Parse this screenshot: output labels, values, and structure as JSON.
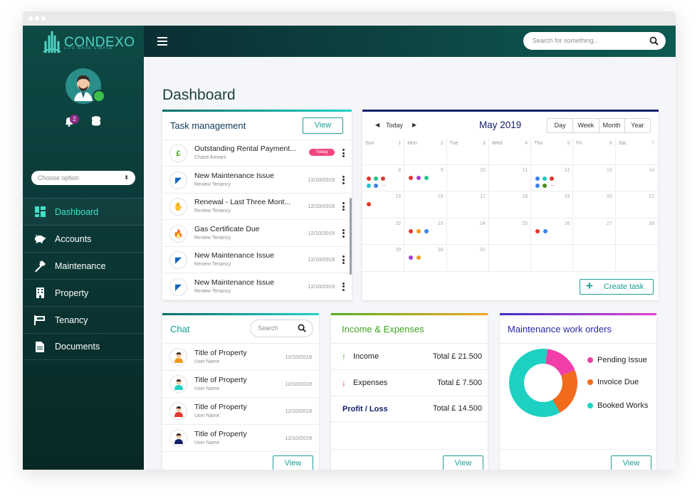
{
  "brand": {
    "name": "CONDEXO",
    "tagline": "LIFE MADE SIMPLE",
    "primary": "#0e4a45",
    "accent": "#3fe0c8"
  },
  "sidebar": {
    "notification_count": "2",
    "choose_option": "Choose option",
    "items": [
      {
        "label": "Dashboard",
        "icon": "dashboard-icon",
        "active": true
      },
      {
        "label": "Accounts",
        "icon": "piggy-bank-icon"
      },
      {
        "label": "Maintenance",
        "icon": "hammer-icon"
      },
      {
        "label": "Property",
        "icon": "building-icon"
      },
      {
        "label": "Tenancy",
        "icon": "flag-icon"
      },
      {
        "label": "Documents",
        "icon": "document-icon"
      }
    ]
  },
  "topbar": {
    "search_placeholder": "Search for something..."
  },
  "page_title": "Dashboard",
  "tasks": {
    "title": "Task management",
    "view_label": "View",
    "today_label": "Today",
    "items": [
      {
        "title": "Outstanding Rental Payment...",
        "sub": "Chase Arrears",
        "date": "",
        "today": true,
        "icon": "pound-icon"
      },
      {
        "title": "New Maintenance Issue",
        "sub": "Review Tenancy",
        "date": "12/10/2019",
        "icon": "paint-roller-icon"
      },
      {
        "title": "Renewal - Last Three Mont...",
        "sub": "Review Tenancy",
        "date": "12/10/2019",
        "icon": "handshake-icon"
      },
      {
        "title": "Gas Certificate Due",
        "sub": "Review Tenancy",
        "date": "12/10/2019",
        "icon": "flame-icon"
      },
      {
        "title": "New Maintenance Issue",
        "sub": "Review Tenancy",
        "date": "12/10/2019",
        "icon": "paint-roller-icon"
      },
      {
        "title": "New Maintenance Issue",
        "sub": "Review Tenancy",
        "date": "12/10/2019",
        "icon": "paint-roller-icon"
      }
    ]
  },
  "calendar": {
    "today_label": "Today",
    "month": "May 2019",
    "views": [
      "Day",
      "Week",
      "Month",
      "Year"
    ],
    "day_names": [
      "Sun",
      "Mon",
      "Tue",
      "Wed",
      "Thu",
      "Fri",
      "Sat"
    ],
    "weeks": [
      [
        "1",
        "2",
        "3",
        "4",
        "5",
        "6",
        "7"
      ],
      [
        "8",
        "9",
        "10",
        "11",
        "12",
        "13",
        "14"
      ],
      [
        "15",
        "16",
        "17",
        "18",
        "19",
        "20",
        "21"
      ],
      [
        "22",
        "23",
        "24",
        "25",
        "26",
        "27",
        "28"
      ],
      [
        "29",
        "30",
        "31",
        "",
        "",
        "",
        ""
      ]
    ],
    "create_label": "Create task",
    "event_colors": {
      "red": "#e0372d",
      "purple": "#a63cd4",
      "green": "#22c68c",
      "blue": "#3b83e8",
      "orange": "#f39a1e",
      "teal": "#20c4c4",
      "navy": "#1c3fa8",
      "olive": "#4f8a1a"
    }
  },
  "chat": {
    "title": "Chat",
    "search_placeholder": "Search",
    "view_label": "View",
    "items": [
      {
        "title": "Title of Property",
        "sub": "User Name",
        "date": "12/10/2019"
      },
      {
        "title": "Title of Property",
        "sub": "User Name",
        "date": "12/10/2019"
      },
      {
        "title": "Title of Property",
        "sub": "User Name",
        "date": "12/10/2019"
      },
      {
        "title": "Title of Property",
        "sub": "User Name",
        "date": "12/10/2019"
      }
    ]
  },
  "income": {
    "title": "Income & Expenses",
    "view_label": "View",
    "rows": [
      {
        "label": "Income",
        "value": "Total £ 21.500"
      },
      {
        "label": "Expenses",
        "value": "Total £ 7.500"
      },
      {
        "label": "Profit / Loss",
        "value": "Total £ 14.500"
      }
    ]
  },
  "maintenance": {
    "title": "Maintenance work orders",
    "view_label": "View",
    "legend": [
      {
        "label": "Pending Issue",
        "color": "#f23ea8"
      },
      {
        "label": "Invoice Due",
        "color": "#f26a1b"
      },
      {
        "label": "Booked Works",
        "color": "#1dd1c2"
      }
    ]
  },
  "chart_data": {
    "type": "pie",
    "categories": [
      "Pending Issue",
      "Invoice Due",
      "Booked Works"
    ],
    "values": [
      17,
      23,
      60
    ],
    "colors": [
      "#f23ea8",
      "#f26a1b",
      "#1dd1c2"
    ]
  }
}
